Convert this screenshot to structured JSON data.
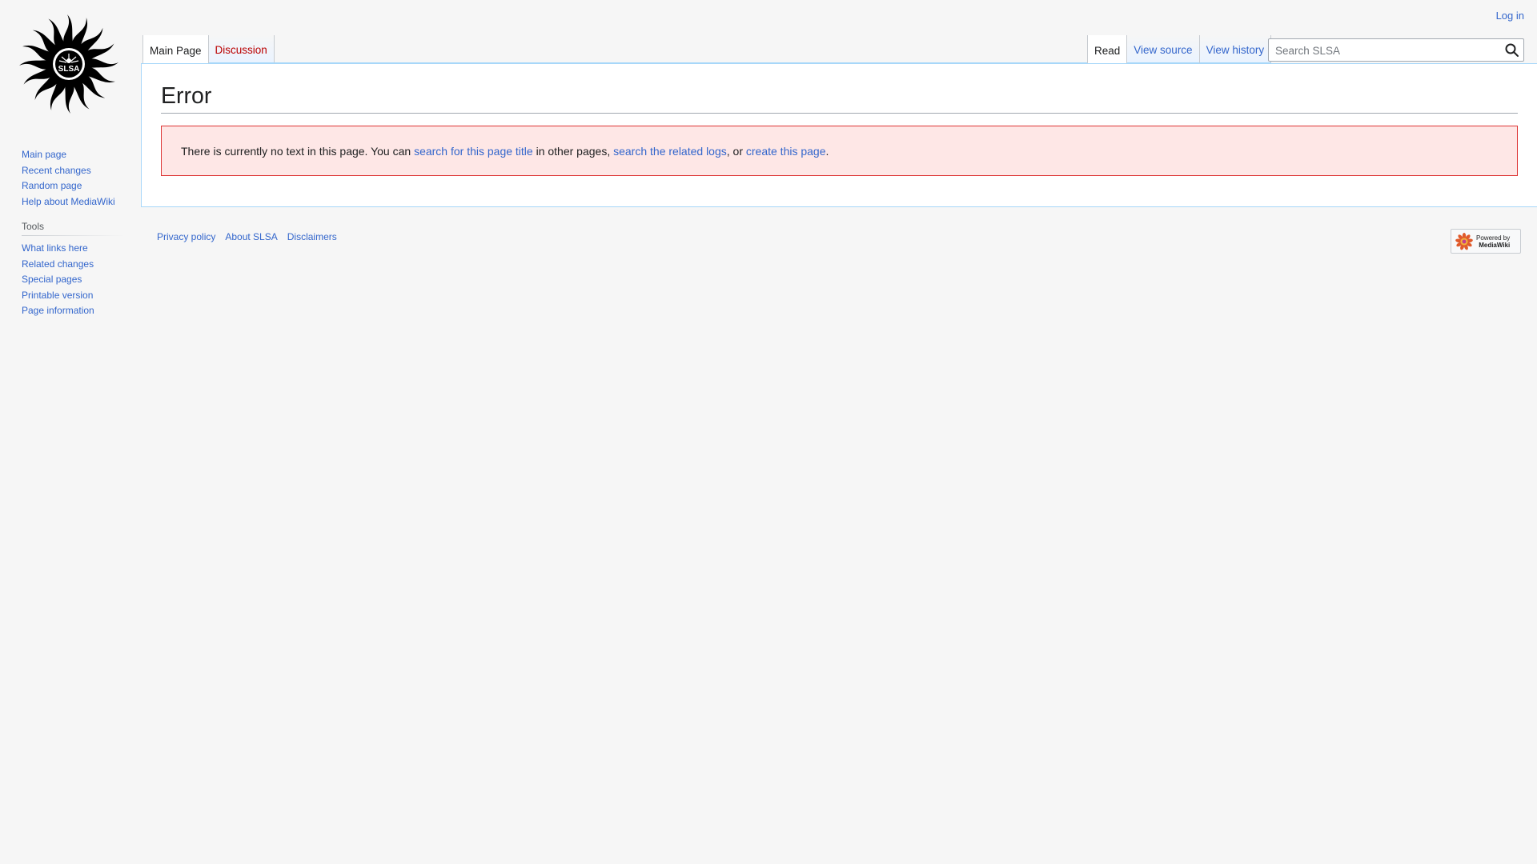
{
  "logo": {
    "text": "SLSA"
  },
  "personal_tools": {
    "login_label": "Log in"
  },
  "tabs": {
    "left": [
      {
        "label": "Main Page",
        "selected": true
      },
      {
        "label": "Discussion",
        "selected": false,
        "redlink": true
      }
    ],
    "right": [
      {
        "label": "Read",
        "selected": true
      },
      {
        "label": "View source",
        "selected": false
      },
      {
        "label": "View history",
        "selected": false
      }
    ]
  },
  "search": {
    "placeholder": "Search SLSA",
    "value": ""
  },
  "page": {
    "title": "Error",
    "message_prefix": "There is currently no text in this page. You can ",
    "link_search_title": "search for this page title",
    "message_middle": " in other pages, ",
    "link_related_logs": "search the related logs",
    "message_or": ", or ",
    "link_create": "create this page",
    "message_suffix": "."
  },
  "sidebar": {
    "navigation": [
      "Main page",
      "Recent changes",
      "Random page",
      "Help about MediaWiki"
    ],
    "tools_heading": "Tools",
    "tools": [
      "What links here",
      "Related changes",
      "Special pages",
      "Printable version",
      "Page information"
    ]
  },
  "footer": {
    "links": [
      "Privacy policy",
      "About SLSA",
      "Disclaimers"
    ],
    "powered_by_line1": "Powered by",
    "powered_by_line2": "MediaWiki"
  },
  "colors": {
    "link": "#3366cc",
    "redlink": "#ba0000",
    "error_bg": "#fee7e6",
    "error_border": "#dd3333",
    "page_bg": "#f6f6f6"
  }
}
